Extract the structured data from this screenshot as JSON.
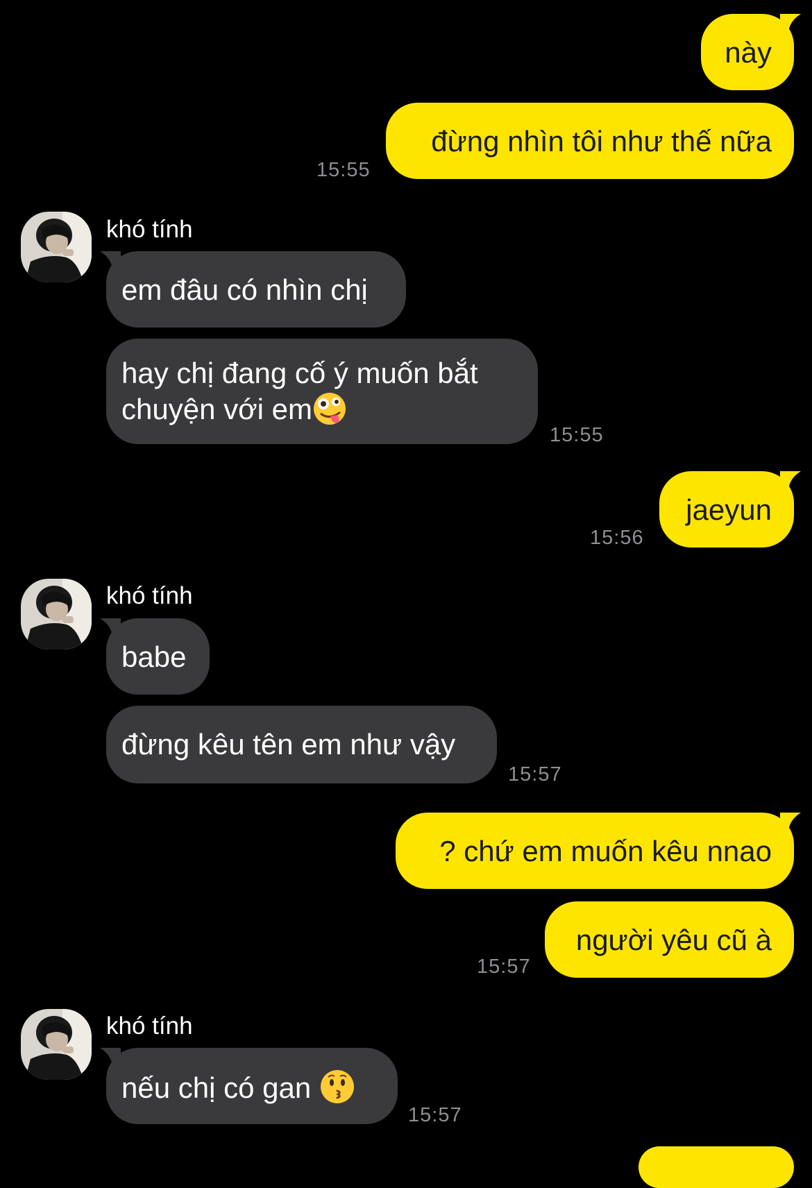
{
  "conversation": {
    "contact_name": "khó tính",
    "messages": [
      {
        "id": "m1",
        "side": "out",
        "text": "này"
      },
      {
        "id": "m2",
        "side": "out",
        "text": "đừng nhìn tôi như thế nữa",
        "time": "15:55"
      },
      {
        "id": "m3",
        "side": "in",
        "text": "em đâu có nhìn chị"
      },
      {
        "id": "m4",
        "side": "in",
        "text": "hay chị đang cố ý muốn bắt chuyện với em",
        "emoji": "zany-face",
        "time": "15:55"
      },
      {
        "id": "m5",
        "side": "out",
        "text": "jaeyun",
        "time": "15:56"
      },
      {
        "id": "m6",
        "side": "in",
        "text": "babe"
      },
      {
        "id": "m7",
        "side": "in",
        "text": "đừng kêu tên em như vậy",
        "time": "15:57"
      },
      {
        "id": "m8",
        "side": "out",
        "text": "? chứ em muốn kêu nnao"
      },
      {
        "id": "m9",
        "side": "out",
        "text": "người yêu cũ à",
        "time": "15:57"
      },
      {
        "id": "m10",
        "side": "in",
        "text": "nếu chị có gan",
        "emoji": "kissing-face",
        "time": "15:57"
      }
    ]
  },
  "colors": {
    "background": "#000000",
    "outgoing_bubble": "#FEE500",
    "incoming_bubble": "#3A3A3C",
    "timestamp": "#8E8E93"
  }
}
